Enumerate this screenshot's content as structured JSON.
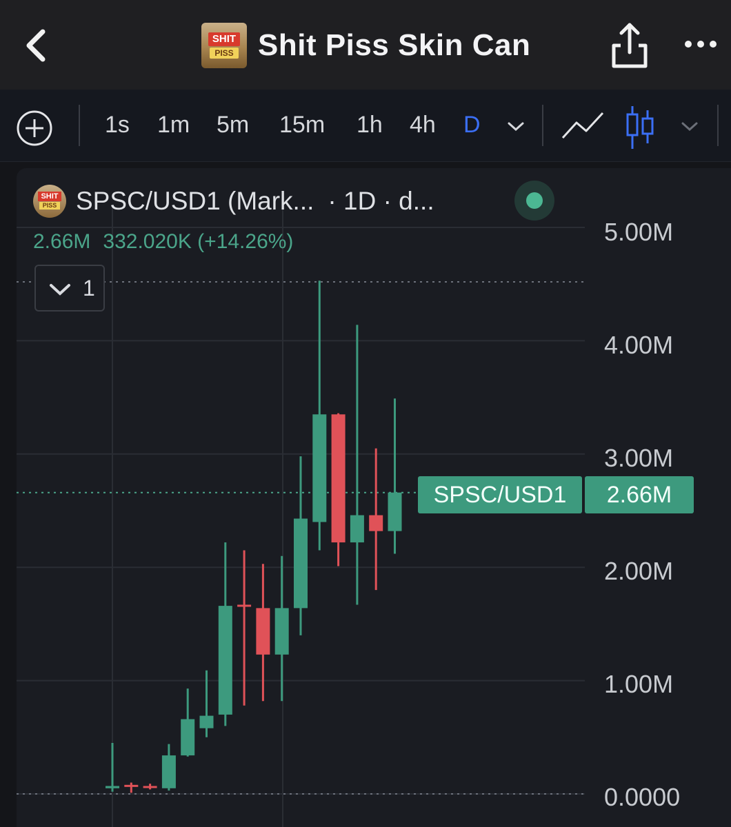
{
  "header": {
    "title": "Shit Piss Skin Can",
    "logo_top_text": "SHIT",
    "logo_bottom_text": "PISS",
    "back_icon": "chevron-left-icon",
    "share_icon": "share-icon",
    "more_icon": "more-horizontal-icon"
  },
  "toolbar": {
    "add_icon": "plus-circle-icon",
    "timeframes": [
      "1s",
      "1m",
      "5m",
      "15m",
      "1h",
      "4h",
      "D"
    ],
    "active_timeframe": "D",
    "chart_types": [
      "line-chart-icon",
      "candlestick-icon"
    ],
    "active_chart_type": "candlestick-icon"
  },
  "legend": {
    "symbol": "SPSC/USD1 (Mark...",
    "interval": "· 1D · d...",
    "last": "2.66M",
    "change": "332.020K (+14.26%)",
    "indicator_count": "1",
    "status": "live"
  },
  "price_tag": {
    "symbol": "SPSC/USD1",
    "value": "2.66M"
  },
  "colors": {
    "up": "#3d9a7e",
    "down": "#e05258",
    "active": "#3b6ff5",
    "background": "#1a1c22"
  },
  "chart_data": {
    "type": "candlestick",
    "title": "",
    "ylim": [
      0,
      5.5
    ],
    "y_unit": "M",
    "yticks": [
      "0.0000",
      "1.00M",
      "2.00M",
      "3.00M",
      "4.00M",
      "5.00M"
    ],
    "ytick_values": [
      0,
      1,
      2,
      3,
      4,
      5
    ],
    "last_price": 2.66,
    "ohlc": [
      {
        "o": 0.05,
        "h": 0.45,
        "l": 0.02,
        "c": 0.07
      },
      {
        "o": 0.08,
        "h": 0.1,
        "l": 0.01,
        "c": 0.07
      },
      {
        "o": 0.07,
        "h": 0.09,
        "l": 0.04,
        "c": 0.06
      },
      {
        "o": 0.05,
        "h": 0.44,
        "l": 0.03,
        "c": 0.34
      },
      {
        "o": 0.34,
        "h": 0.93,
        "l": 0.33,
        "c": 0.66
      },
      {
        "o": 0.58,
        "h": 1.09,
        "l": 0.5,
        "c": 0.69
      },
      {
        "o": 0.7,
        "h": 2.22,
        "l": 0.6,
        "c": 1.66
      },
      {
        "o": 1.67,
        "h": 2.15,
        "l": 0.78,
        "c": 1.66
      },
      {
        "o": 1.64,
        "h": 2.03,
        "l": 0.82,
        "c": 1.23
      },
      {
        "o": 1.23,
        "h": 2.1,
        "l": 0.82,
        "c": 1.64
      },
      {
        "o": 1.64,
        "h": 2.98,
        "l": 1.4,
        "c": 2.43
      },
      {
        "o": 2.4,
        "h": 4.53,
        "l": 2.15,
        "c": 3.35
      },
      {
        "o": 3.35,
        "h": 3.36,
        "l": 2.01,
        "c": 2.22
      },
      {
        "o": 2.22,
        "h": 4.14,
        "l": 1.67,
        "c": 2.46
      },
      {
        "o": 2.46,
        "h": 3.05,
        "l": 1.8,
        "c": 2.32
      },
      {
        "o": 2.32,
        "h": 3.49,
        "l": 2.12,
        "c": 2.66
      }
    ]
  }
}
